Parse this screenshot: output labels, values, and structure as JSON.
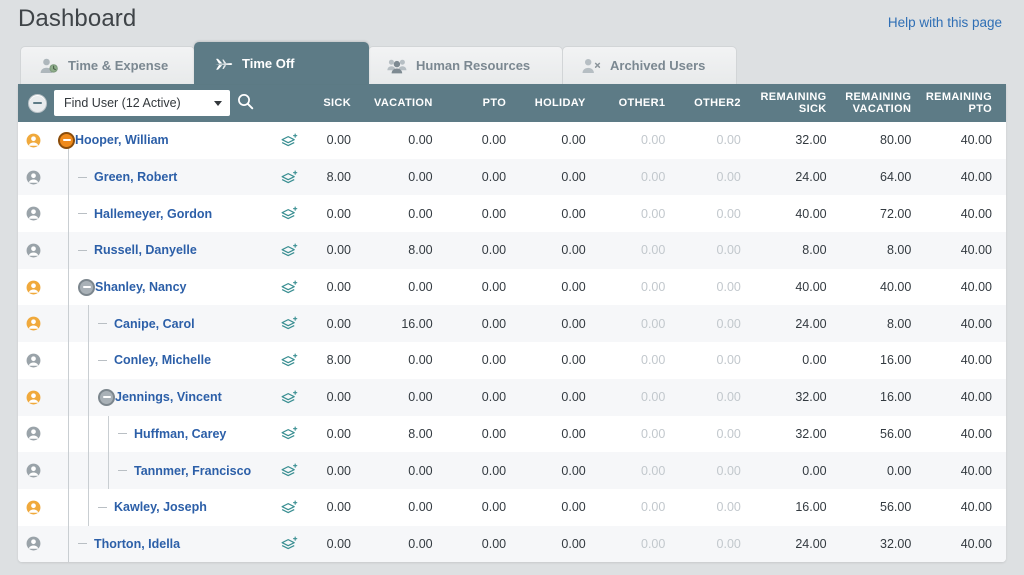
{
  "header": {
    "title": "Dashboard",
    "help_link": "Help with this page"
  },
  "tabs": [
    {
      "label": "Time & Expense",
      "icon": "person-clock-icon",
      "active": false
    },
    {
      "label": "Time Off",
      "icon": "airplane-icon",
      "active": true
    },
    {
      "label": "Human Resources",
      "icon": "people-group-icon",
      "active": false
    },
    {
      "label": "Archived Users",
      "icon": "person-remove-icon",
      "active": false
    }
  ],
  "toolbar": {
    "collapse_all_label": "collapse-all",
    "find_user_value": "Find User (12 Active)",
    "search_icon": "search-icon",
    "dropdown_icon": "chevron-down-icon"
  },
  "columns": [
    {
      "line1": "SICK",
      "line2": ""
    },
    {
      "line1": "VACATION",
      "line2": ""
    },
    {
      "line1": "PTO",
      "line2": ""
    },
    {
      "line1": "HOLIDAY",
      "line2": ""
    },
    {
      "line1": "OTHER1",
      "line2": ""
    },
    {
      "line1": "OTHER2",
      "line2": ""
    },
    {
      "line1": "REMAINING",
      "line2": "SICK"
    },
    {
      "line1": "REMAINING",
      "line2": "VACATION"
    },
    {
      "line1": "REMAINING",
      "line2": "PTO"
    }
  ],
  "colors": {
    "page_bg": "#dde0e2",
    "header_bar": "#5d7b86",
    "tab_active_bg": "#5d7b86",
    "link": "#2c5fa8",
    "help_link": "#2f6fb5",
    "manager_person": "#f0a93c",
    "staff_person": "#9aa3a9",
    "layers_icon": "#3a8f92",
    "muted_value": "#c2c8cd"
  },
  "rows": [
    {
      "name": "Hooper, William",
      "depth": 0,
      "person": "manager",
      "toggle": "orange",
      "layers_icon": "add-layers-icon",
      "values": [
        "0.00",
        "0.00",
        "0.00",
        "0.00",
        "0.00",
        "0.00",
        "32.00",
        "80.00",
        "40.00"
      ]
    },
    {
      "name": "Green, Robert",
      "depth": 1,
      "person": "staff",
      "toggle": null,
      "layers_icon": "add-layers-icon",
      "values": [
        "8.00",
        "0.00",
        "0.00",
        "0.00",
        "0.00",
        "0.00",
        "24.00",
        "64.00",
        "40.00"
      ]
    },
    {
      "name": "Hallemeyer, Gordon",
      "depth": 1,
      "person": "staff",
      "toggle": null,
      "layers_icon": "add-layers-icon",
      "values": [
        "0.00",
        "0.00",
        "0.00",
        "0.00",
        "0.00",
        "0.00",
        "40.00",
        "72.00",
        "40.00"
      ]
    },
    {
      "name": "Russell, Danyelle",
      "depth": 1,
      "person": "staff",
      "toggle": null,
      "layers_icon": "add-layers-icon",
      "values": [
        "0.00",
        "8.00",
        "0.00",
        "0.00",
        "0.00",
        "0.00",
        "8.00",
        "8.00",
        "40.00"
      ]
    },
    {
      "name": "Shanley, Nancy",
      "depth": 1,
      "person": "manager",
      "toggle": "grey",
      "layers_icon": "add-layers-icon",
      "values": [
        "0.00",
        "0.00",
        "0.00",
        "0.00",
        "0.00",
        "0.00",
        "40.00",
        "40.00",
        "40.00"
      ]
    },
    {
      "name": "Canipe, Carol",
      "depth": 2,
      "person": "manager",
      "toggle": null,
      "layers_icon": "add-layers-icon",
      "values": [
        "0.00",
        "16.00",
        "0.00",
        "0.00",
        "0.00",
        "0.00",
        "24.00",
        "8.00",
        "40.00"
      ]
    },
    {
      "name": "Conley, Michelle",
      "depth": 2,
      "person": "staff",
      "toggle": null,
      "layers_icon": "add-layers-icon",
      "values": [
        "8.00",
        "0.00",
        "0.00",
        "0.00",
        "0.00",
        "0.00",
        "0.00",
        "16.00",
        "40.00"
      ]
    },
    {
      "name": "Jennings, Vincent",
      "depth": 2,
      "person": "manager",
      "toggle": "grey",
      "layers_icon": "add-layers-icon",
      "values": [
        "0.00",
        "0.00",
        "0.00",
        "0.00",
        "0.00",
        "0.00",
        "32.00",
        "16.00",
        "40.00"
      ]
    },
    {
      "name": "Huffman, Carey",
      "depth": 3,
      "person": "staff",
      "toggle": null,
      "layers_icon": "add-layers-icon",
      "values": [
        "0.00",
        "8.00",
        "0.00",
        "0.00",
        "0.00",
        "0.00",
        "32.00",
        "56.00",
        "40.00"
      ]
    },
    {
      "name": "Tannmer, Francisco",
      "depth": 3,
      "person": "staff",
      "toggle": null,
      "layers_icon": "add-layers-icon",
      "values": [
        "0.00",
        "0.00",
        "0.00",
        "0.00",
        "0.00",
        "0.00",
        "0.00",
        "0.00",
        "40.00"
      ]
    },
    {
      "name": "Kawley, Joseph",
      "depth": 2,
      "person": "manager",
      "toggle": null,
      "layers_icon": "add-layers-icon",
      "values": [
        "0.00",
        "0.00",
        "0.00",
        "0.00",
        "0.00",
        "0.00",
        "16.00",
        "56.00",
        "40.00"
      ]
    },
    {
      "name": "Thorton, Idella",
      "depth": 1,
      "person": "staff",
      "toggle": null,
      "layers_icon": "add-layers-icon",
      "values": [
        "0.00",
        "0.00",
        "0.00",
        "0.00",
        "0.00",
        "0.00",
        "24.00",
        "32.00",
        "40.00"
      ]
    }
  ]
}
